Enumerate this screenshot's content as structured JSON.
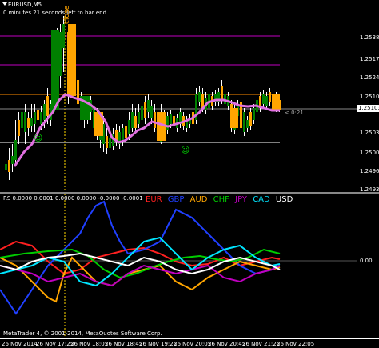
{
  "window": {
    "symbol_title": "EURUSD,M5",
    "countdown_text": "0 minutes 21 seconds left to bar end",
    "close_label": "close",
    "ask_label": "< 0:21"
  },
  "price_axis": {
    "labels": [
      "1.25385",
      "1.25245",
      "1.25105",
      "1.25030",
      "1.25005",
      "1.24965",
      "1.24935"
    ],
    "current_price": "1.25103",
    "extra_labels": [
      "1.25175",
      "1.25030"
    ]
  },
  "indicator": {
    "header": "RS 0.0000 0.0001 0.0000 0.0000 -0.0000 -0.0001",
    "legend": [
      {
        "name": "EUR",
        "color": "#ff2020"
      },
      {
        "name": "GBP",
        "color": "#2040ff"
      },
      {
        "name": "AUD",
        "color": "#ffa500"
      },
      {
        "name": "CHF",
        "color": "#00cc00"
      },
      {
        "name": "JPY",
        "color": "#c000c0"
      },
      {
        "name": "CAD",
        "color": "#00e5ff"
      },
      {
        "name": "USD",
        "color": "#ffffff"
      }
    ],
    "zero_label": "0.00"
  },
  "time_axis": {
    "labels": [
      "26 Nov 2014",
      "26 Nov 17:25",
      "26 Nov 18:05",
      "26 Nov 18:45",
      "26 Nov 19:25",
      "26 Nov 20:05",
      "26 Nov 20:45",
      "26 Nov 21:25",
      "26 Nov 22:05"
    ]
  },
  "footer": {
    "copyright": "MetaTrader 4, © 2001-2014, MetaQuotes Software Corp."
  },
  "colors": {
    "bull": "#008000",
    "bear": "#ffa500",
    "ma": "#e070e0",
    "magenta_line": "#c000c0",
    "orange_line": "#ff8c00",
    "white_line": "#ffffff"
  }
}
